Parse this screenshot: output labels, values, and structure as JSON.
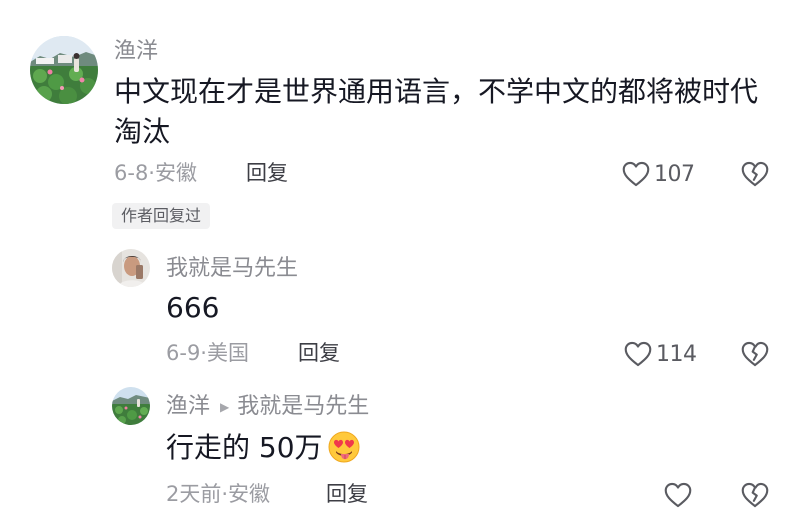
{
  "comments": [
    {
      "author": "渔洋",
      "text_line1": "中文现在才是世界通用语言，不学中文的都将被时代",
      "text_line2": "淘汰",
      "date_location": "6-8·安徽",
      "reply_label": "回复",
      "like_count": "107",
      "author_badge": "作者回复过"
    }
  ],
  "replies": [
    {
      "author": "我就是马先生",
      "text": "666",
      "date_location": "6-9·美国",
      "reply_label": "回复",
      "like_count": "114"
    },
    {
      "author": "渔洋",
      "reply_to": "我就是马先生",
      "text": "行走的 50万",
      "date_location": "2天前·安徽",
      "reply_label": "回复",
      "like_count": ""
    }
  ],
  "icons": {
    "like": "heart-outline-icon",
    "dislike": "broken-heart-icon",
    "reply_arrow": "triangle-right-icon",
    "emoji": "heart-eyes-tongue-emoji"
  },
  "colors": {
    "text_primary": "#161823",
    "text_secondary": "#8a8b91",
    "badge_background": "#f1f1f2"
  }
}
